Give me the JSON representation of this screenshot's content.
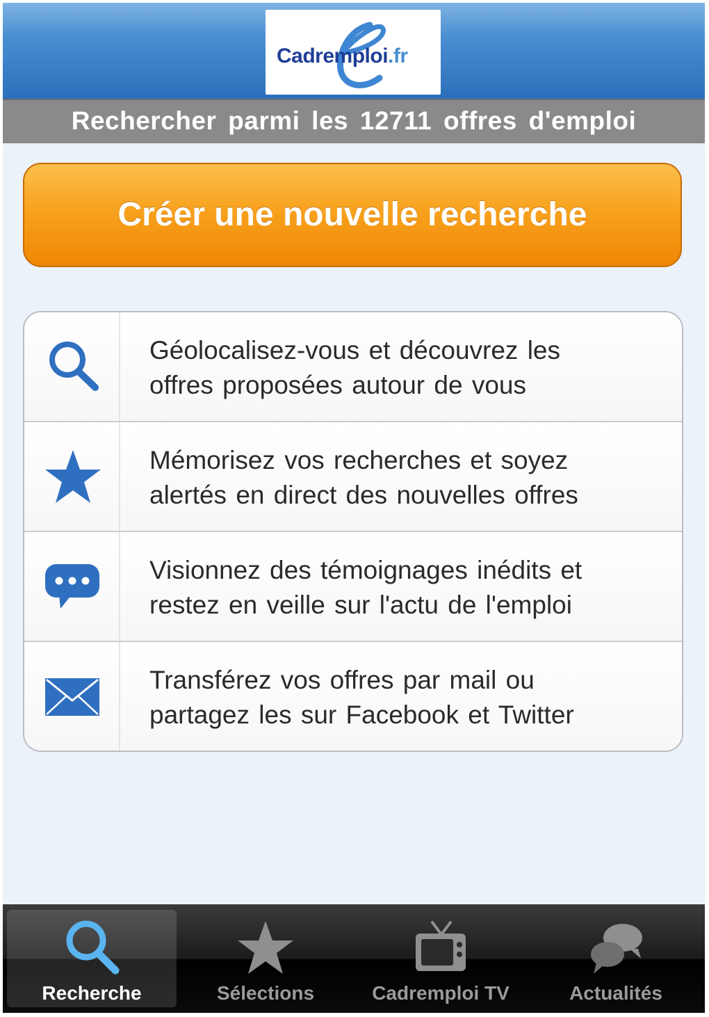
{
  "header": {
    "logo": {
      "name": "Cadremploi",
      "suffix": ".fr",
      "icon": "cadremploi-logo"
    },
    "subtitle": "Rechercher parmi les 12711 offres d'emploi"
  },
  "cta": {
    "label": "Créer une nouvelle recherche"
  },
  "features": [
    {
      "icon": "search-icon",
      "line1": "Géolocalisez-vous et découvrez les",
      "line2": "offres proposées autour de vous"
    },
    {
      "icon": "star-icon",
      "line1": "Mémorisez vos recherches et soyez",
      "line2": "alertés en direct des nouvelles offres"
    },
    {
      "icon": "speech-bubble-icon",
      "line1": "Visionnez des témoignages inédits et",
      "line2": "restez en veille sur l'actu de l'emploi"
    },
    {
      "icon": "envelope-icon",
      "line1": "Transférez vos offres par mail ou",
      "line2": "partagez les sur Facebook et Twitter"
    }
  ],
  "tabs": [
    {
      "label": "Recherche",
      "icon": "search-icon",
      "active": true
    },
    {
      "label": "Sélections",
      "icon": "star-icon",
      "active": false
    },
    {
      "label": "Cadremploi TV",
      "icon": "tv-icon",
      "active": false
    },
    {
      "label": "Actualités",
      "icon": "chat-bubbles-icon",
      "active": false
    }
  ],
  "colors": {
    "accent_blue": "#2f6fc0",
    "cta_orange": "#f59a14",
    "header_blue": "#3a7fc6",
    "tab_active": "#5ab4f0"
  }
}
